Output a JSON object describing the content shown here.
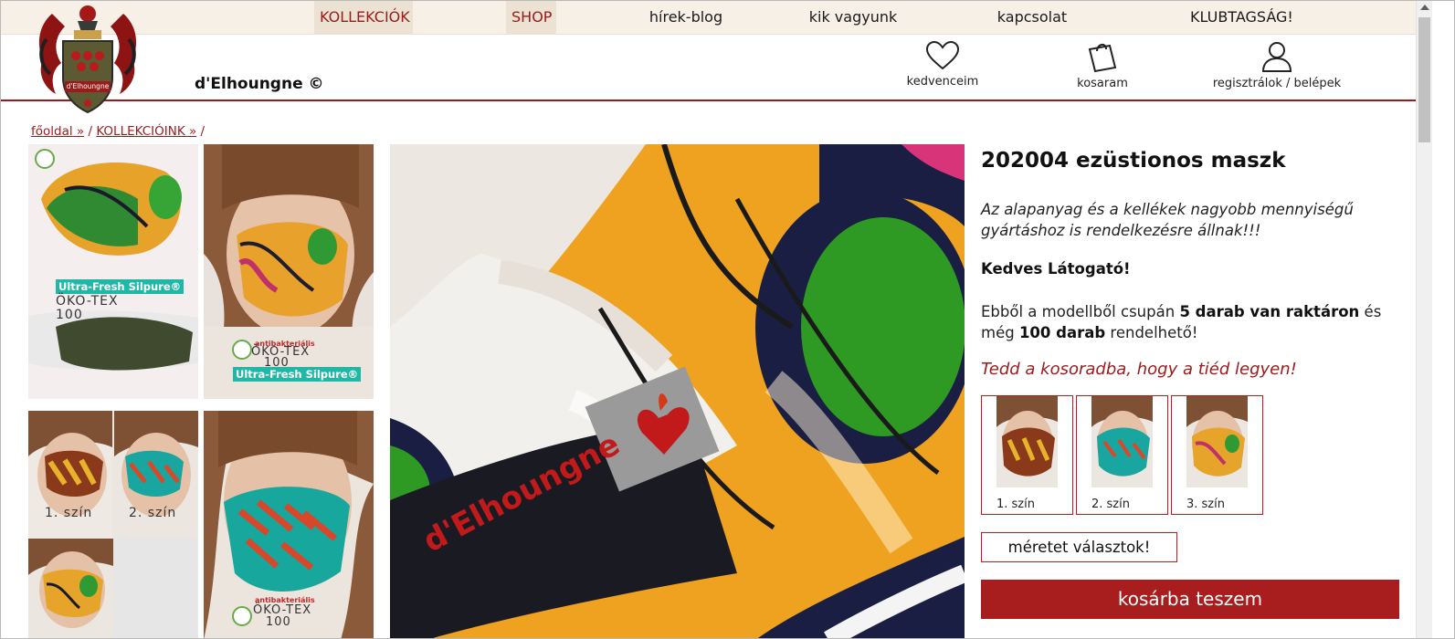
{
  "nav": {
    "items": [
      {
        "label": "KOLLEKCIÓK",
        "active": true
      },
      {
        "label": "SHOP",
        "active": true
      },
      {
        "label": "hírek-blog",
        "active": false
      },
      {
        "label": "kik vagyunk",
        "active": false
      },
      {
        "label": "kapcsolat",
        "active": false
      },
      {
        "label": "KLUBTAGSÁG!",
        "active": false
      }
    ]
  },
  "header": {
    "brand": "d'Elhoungne ©",
    "logo_text": "d'Elhoungne",
    "favorites_label": "kedvenceim",
    "cart_label": "kosaram",
    "account_label": "regisztrálok / belépek",
    "favorites_icon": "heart-icon",
    "cart_icon": "shopping-bag-icon",
    "account_icon": "user-icon"
  },
  "breadcrumb": {
    "home": "főoldal »",
    "sep1": " / ",
    "collections": "KOLLEKCIÓINK »",
    "sep2": " /"
  },
  "gallery": {
    "thumb1": {
      "badge": "Ultra-Fresh Silpure®",
      "oeko1": "ÖKO-TEX",
      "oeko2": "100"
    },
    "thumb2": {
      "antibac": "antibakteriális",
      "oeko1": "ÖKO-TEX",
      "oeko2": "100",
      "badge": "Ultra-Fresh Silpure®"
    },
    "thumb3": {
      "color1": "1. szín",
      "color2": "2. szín"
    },
    "thumb5": {
      "antibac": "antibakteriális",
      "oeko1": "ÖKO-TEX",
      "oeko2": "100"
    },
    "main_label": "d'Elhoungne"
  },
  "product": {
    "title": "202004 ezüstionos maszk",
    "description": "Az alapanyag és a kellékek nagyobb mennyiségű gyártáshoz is rendelkezésre állnak!!!",
    "greeting": "Kedves Látogató!",
    "stock_pre": "Ebből a modellből csupán ",
    "stock_bold1": "5 darab van raktáron",
    "stock_mid": " és még ",
    "stock_bold2": "100 darab",
    "stock_post": " rendelhető!",
    "cta": "Tedd a kosoradba, hogy a tiéd legyen!",
    "swatches": [
      {
        "label": "1. szín"
      },
      {
        "label": "2. szín"
      },
      {
        "label": "3. szín"
      }
    ],
    "size_button": "méretet választok!",
    "cart_button": "kosárba teszem"
  },
  "colors": {
    "accent": "#9b1b1b",
    "button": "#a81d1d",
    "nav_bg": "#f6f0e6"
  }
}
